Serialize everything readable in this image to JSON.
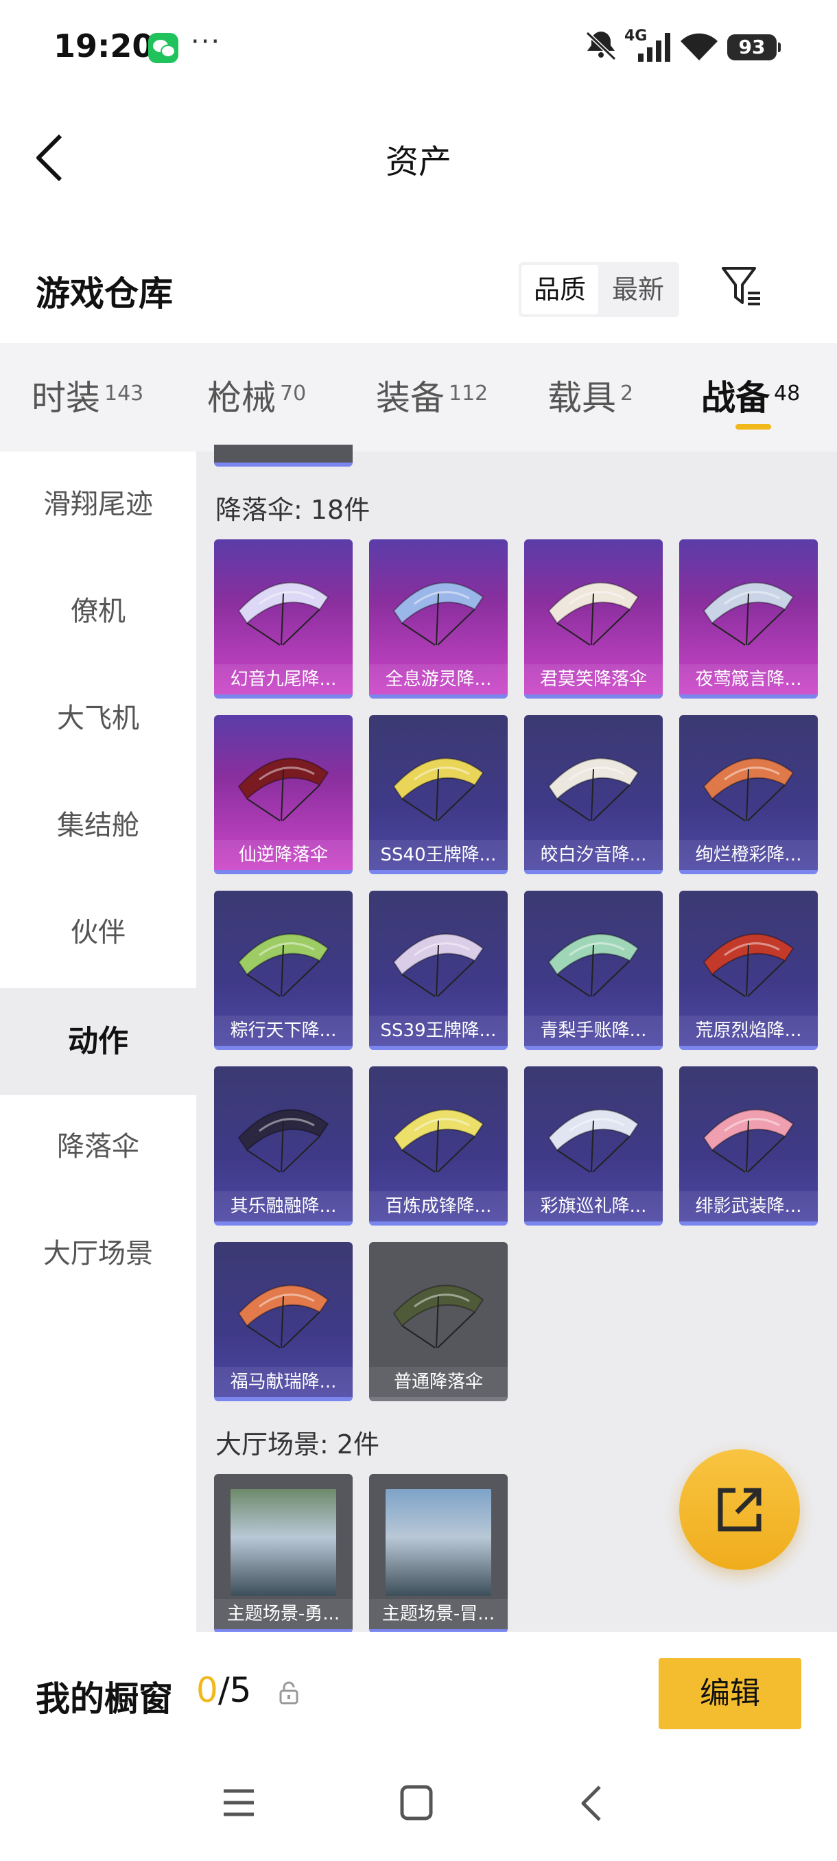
{
  "status_bar": {
    "time": "19:20",
    "network": "4G",
    "battery": "93"
  },
  "header": {
    "title": "资产"
  },
  "warehouse": {
    "title": "游戏仓库",
    "sort_quality": "品质",
    "sort_latest": "最新"
  },
  "tabs": [
    {
      "label": "时装",
      "count": "143"
    },
    {
      "label": "枪械",
      "count": "70"
    },
    {
      "label": "装备",
      "count": "112"
    },
    {
      "label": "载具",
      "count": "2"
    },
    {
      "label": "战备",
      "count": "48"
    }
  ],
  "sidebar": {
    "items": [
      "滑翔尾迹",
      "僚机",
      "大飞机",
      "集结舱",
      "伙伴",
      "动作",
      "降落伞",
      "大厅场景"
    ],
    "active": "动作"
  },
  "sections": {
    "parachute": {
      "title": "降落伞: 18件",
      "items": [
        {
          "label": "幻音九尾降...",
          "tier": "pink",
          "color": "#ddd8f5"
        },
        {
          "label": "全息游灵降...",
          "tier": "pink",
          "color": "#9bb6e8"
        },
        {
          "label": "君莫笑降落伞",
          "tier": "pink",
          "color": "#efe6dc"
        },
        {
          "label": "夜莺箴言降...",
          "tier": "pink",
          "color": "#c9d4e6"
        },
        {
          "label": "仙逆降落伞",
          "tier": "pink",
          "color": "#7a1b22"
        },
        {
          "label": "SS40王牌降...",
          "tier": "purple",
          "color": "#e9d558"
        },
        {
          "label": "皎白汐音降...",
          "tier": "purple",
          "color": "#ece8e0"
        },
        {
          "label": "绚烂橙彩降...",
          "tier": "purple",
          "color": "#e0794a"
        },
        {
          "label": "粽行天下降...",
          "tier": "purple",
          "color": "#9ccc63"
        },
        {
          "label": "SS39王牌降...",
          "tier": "purple",
          "color": "#d9cde8"
        },
        {
          "label": "青梨手账降...",
          "tier": "purple",
          "color": "#9fd6b8"
        },
        {
          "label": "荒原烈焰降...",
          "tier": "purple",
          "color": "#c33a2b"
        },
        {
          "label": "其乐融融降...",
          "tier": "purple",
          "color": "#2c2740"
        },
        {
          "label": "百炼成锋降...",
          "tier": "purple",
          "color": "#ece06a"
        },
        {
          "label": "彩旗巡礼降...",
          "tier": "purple",
          "color": "#dfe6f2"
        },
        {
          "label": "绯影武装降...",
          "tier": "purple",
          "color": "#ef9fb0"
        },
        {
          "label": "福马献瑞降...",
          "tier": "purple",
          "color": "#e27a4c"
        },
        {
          "label": "普通降落伞",
          "tier": "gray",
          "color": "#4f5a38"
        }
      ]
    },
    "lobby": {
      "title": "大厅场景: 2件",
      "items": [
        {
          "label": "主题场景-勇...",
          "tier": "scene",
          "color": "#6d8a6a"
        },
        {
          "label": "主题场景-冒...",
          "tier": "scene",
          "color": "#7ea3c8"
        }
      ]
    }
  },
  "showcase": {
    "title": "我的橱窗",
    "used": "0",
    "total": "/5",
    "edit_label": "编辑"
  }
}
